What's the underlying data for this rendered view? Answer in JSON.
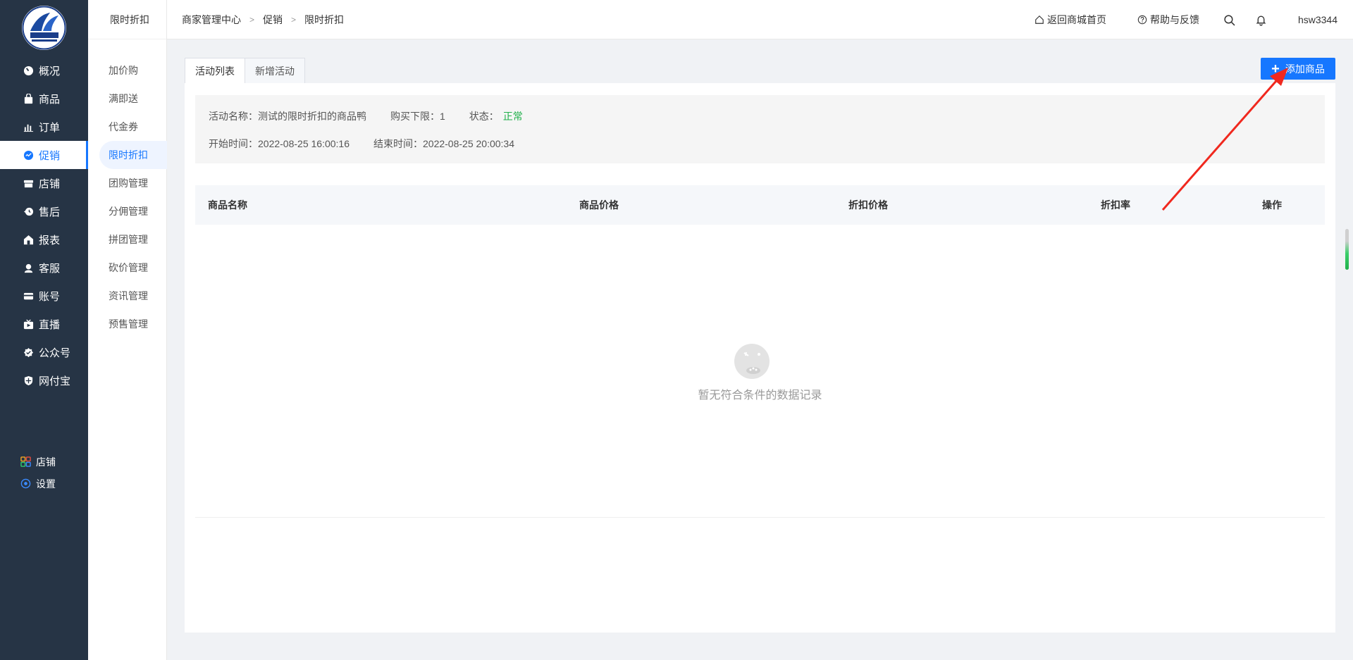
{
  "sidebar": {
    "items": [
      {
        "label": "概况",
        "icon": "gauge-icon"
      },
      {
        "label": "商品",
        "icon": "bag-icon"
      },
      {
        "label": "订单",
        "icon": "bar-chart-icon"
      },
      {
        "label": "促销",
        "icon": "promo-icon",
        "active": true
      },
      {
        "label": "店铺",
        "icon": "store-icon"
      },
      {
        "label": "售后",
        "icon": "clock-arrow-icon"
      },
      {
        "label": "报表",
        "icon": "report-house-icon"
      },
      {
        "label": "客服",
        "icon": "headset-icon"
      },
      {
        "label": "账号",
        "icon": "card-icon"
      },
      {
        "label": "直播",
        "icon": "live-icon"
      },
      {
        "label": "公众号",
        "icon": "check-badge-icon"
      },
      {
        "label": "网付宝",
        "icon": "shield-icon"
      }
    ],
    "bottom": [
      {
        "label": "店铺",
        "icon": "grid-apps-icon"
      },
      {
        "label": "设置",
        "icon": "settings-circle-icon"
      }
    ]
  },
  "subbar": {
    "title": "限时折扣",
    "items": [
      "加价购",
      "满即送",
      "代金券",
      "限时折扣",
      "团购管理",
      "分佣管理",
      "拼团管理",
      "砍价管理",
      "资讯管理",
      "预售管理"
    ],
    "active_index": 3
  },
  "header": {
    "breadcrumb": [
      "商家管理中心",
      "促销",
      "限时折扣"
    ],
    "home_link": "返回商城首页",
    "help_link": "帮助与反馈",
    "username": "hsw3344"
  },
  "tabs": [
    "活动列表",
    "新增活动"
  ],
  "add_button": "添加商品",
  "activity": {
    "name_label": "活动名称：",
    "name_value": "测试的限时折扣的商品鸭",
    "limit_label": "购买下限：",
    "limit_value": "1",
    "status_label": "状态：",
    "status_value": "正常",
    "start_label": "开始时间：",
    "start_value": "2022-08-25 16:00:16",
    "end_label": "结束时间：",
    "end_value": "2022-08-25 20:00:34"
  },
  "table": {
    "columns": [
      "商品名称",
      "商品价格",
      "折扣价格",
      "折扣率",
      "操作"
    ],
    "empty_text": "暂无符合条件的数据记录"
  },
  "colors": {
    "sidebar_bg": "#263445",
    "accent": "#1677ff",
    "status_ok": "#1fb04a",
    "annotation_arrow": "#f0281e"
  }
}
